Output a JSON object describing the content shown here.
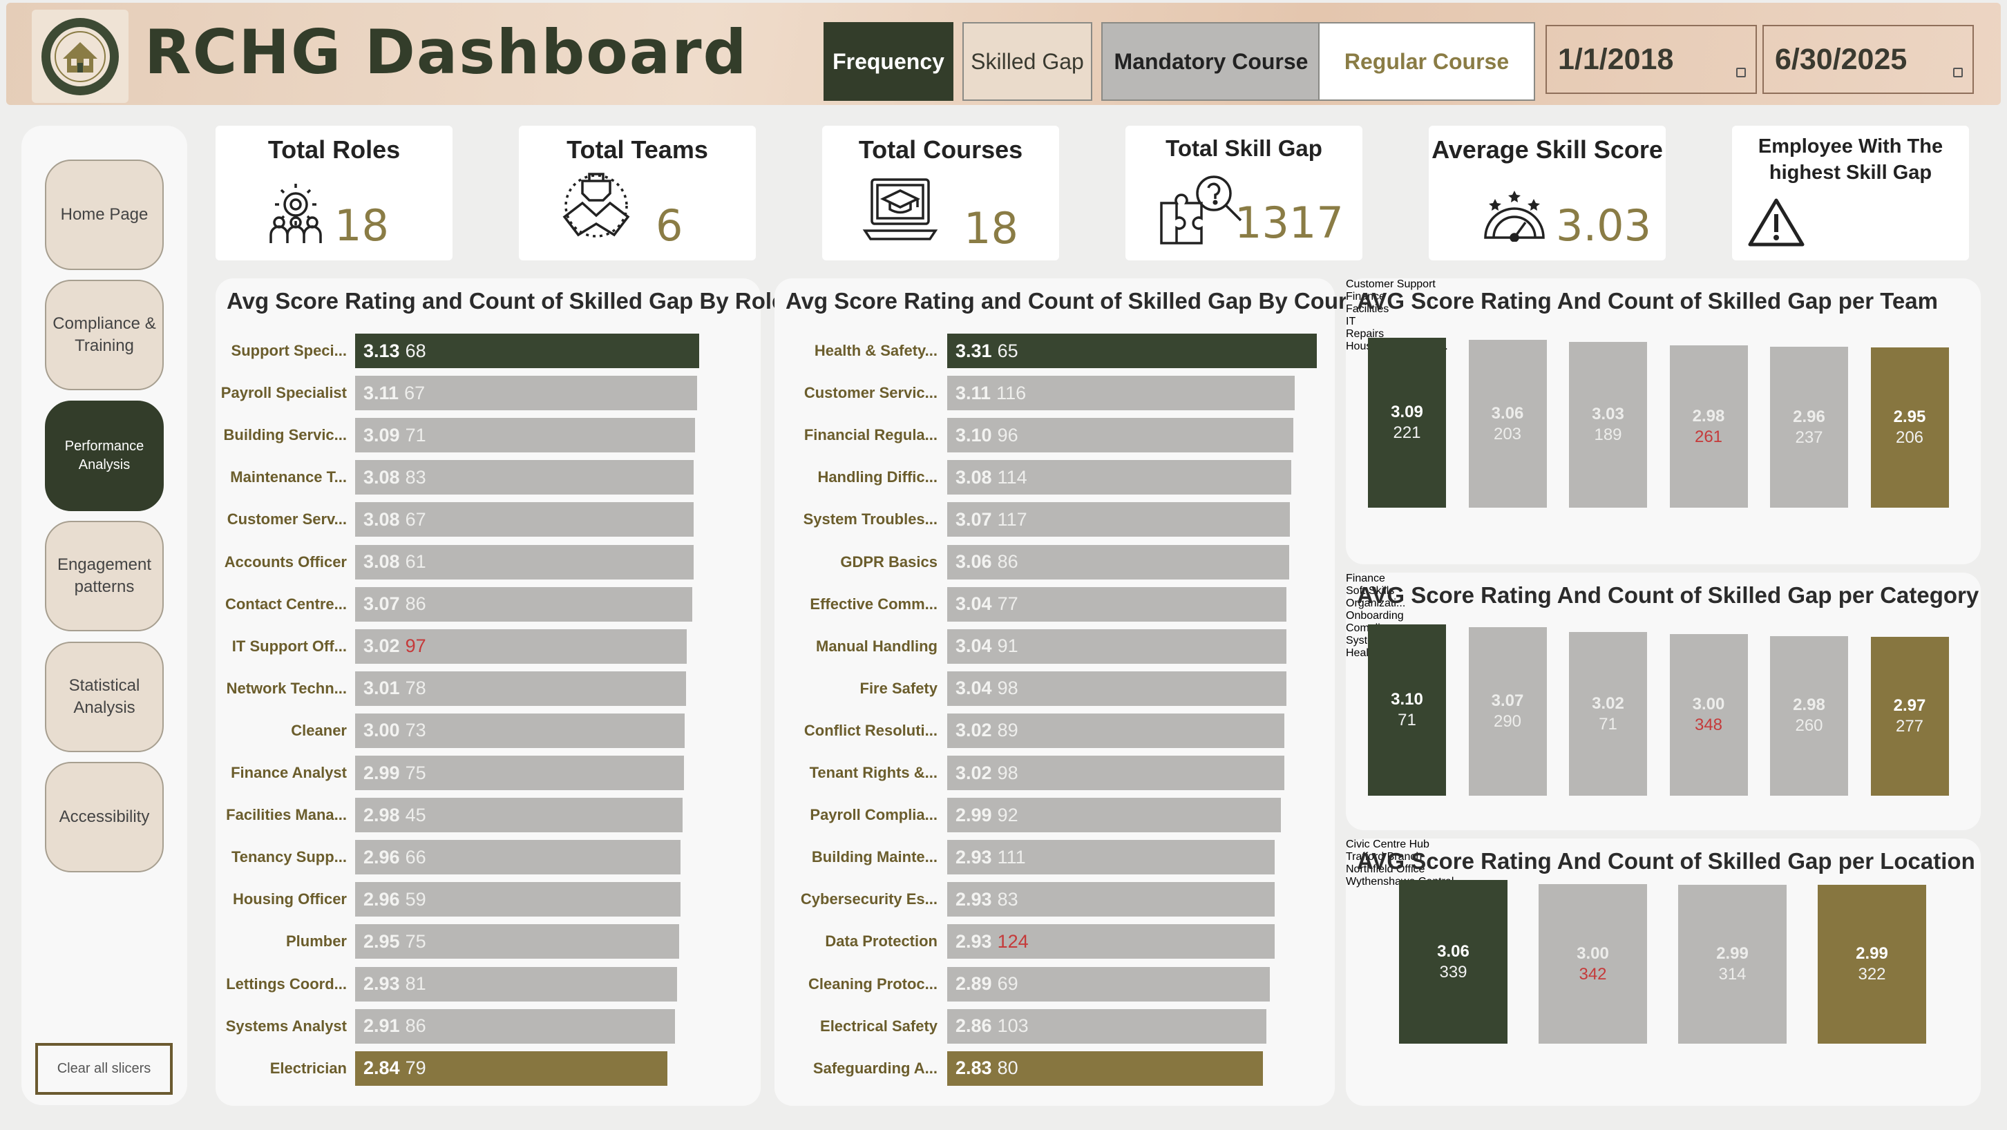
{
  "header": {
    "title": "RCHG Dashboard",
    "logo_text": "WYTHENSHAWE COMMUNITY HOUSING GROUP",
    "toggles": [
      {
        "label": "Frequency",
        "state": "active"
      },
      {
        "label": "Skilled Gap",
        "state": "inactive"
      },
      {
        "label": "Mandatory Course",
        "state": "selected"
      },
      {
        "label": "Regular Course",
        "state": "unselected"
      }
    ],
    "date_start": "1/1/2018",
    "date_end": "6/30/2025"
  },
  "sidebar": {
    "items": [
      "Home Page",
      "Compliance & Training",
      "Performance Analysis",
      "Engagement patterns",
      "Statistical Analysis",
      "Accessibility"
    ],
    "active_index": 2,
    "clear_label": "Clear all slicers"
  },
  "kpis": [
    {
      "title": "Total Roles",
      "value": "18",
      "icon": "team-gear-icon"
    },
    {
      "title": "Total Teams",
      "value": "6",
      "icon": "handshake-icon"
    },
    {
      "title": "Total Courses",
      "value": "18",
      "icon": "laptop-graduation-icon"
    },
    {
      "title": "Total Skill Gap",
      "value": "1317",
      "icon": "puzzle-search-icon"
    },
    {
      "title": "Average Skill Score",
      "value": "3.03",
      "icon": "gauge-stars-icon"
    },
    {
      "title": "Employee With The highest Skill Gap",
      "value": "",
      "icon": "warning-icon"
    }
  ],
  "colors": {
    "dark_green": "#384530",
    "grey": "#b8b7b5",
    "olive": "#877640",
    "label_brown": "#6b5d2c",
    "count_red": "#c53a3a"
  },
  "chart_data": [
    {
      "type": "bar",
      "orientation": "horizontal",
      "title": "Avg Score Rating and Count of Skilled Gap By Role",
      "categories": [
        "Support Speci...",
        "Payroll Specialist",
        "Building Servic...",
        "Maintenance T...",
        "Customer Serv...",
        "Accounts Officer",
        "Contact Centre...",
        "IT Support Off...",
        "Network Techn...",
        "Cleaner",
        "Finance Analyst",
        "Facilities Mana...",
        "Tenancy Supp...",
        "Housing Officer",
        "Plumber",
        "Lettings Coord...",
        "Systems Analyst",
        "Electrician"
      ],
      "series": [
        {
          "name": "Avg Score Rating",
          "values": [
            3.13,
            3.11,
            3.09,
            3.08,
            3.08,
            3.08,
            3.07,
            3.02,
            3.01,
            3.0,
            2.99,
            2.98,
            2.96,
            2.96,
            2.95,
            2.93,
            2.91,
            2.84
          ]
        },
        {
          "name": "Count of Skilled Gap",
          "values": [
            68,
            67,
            71,
            83,
            67,
            61,
            86,
            97,
            78,
            73,
            75,
            45,
            66,
            59,
            75,
            81,
            86,
            79
          ]
        }
      ],
      "highlight": {
        "max_index": 0,
        "min_index": 17,
        "max_count_index": 7
      }
    },
    {
      "type": "bar",
      "orientation": "horizontal",
      "title": "Avg Score Rating and Count of Skilled Gap By Course",
      "categories": [
        "Health & Safety...",
        "Customer Servic...",
        "Financial Regula...",
        "Handling Diffic...",
        "System Troubles...",
        "GDPR Basics",
        "Effective Comm...",
        "Manual Handling",
        "Fire Safety",
        "Conflict Resoluti...",
        "Tenant Rights &...",
        "Payroll Complia...",
        "Building Mainte...",
        "Cybersecurity Es...",
        "Data Protection",
        "Cleaning Protoc...",
        "Electrical Safety",
        "Safeguarding A..."
      ],
      "series": [
        {
          "name": "Avg Score Rating",
          "values": [
            3.31,
            3.11,
            3.1,
            3.08,
            3.07,
            3.06,
            3.04,
            3.04,
            3.04,
            3.02,
            3.02,
            2.99,
            2.93,
            2.93,
            2.93,
            2.89,
            2.86,
            2.83
          ]
        },
        {
          "name": "Count of Skilled Gap",
          "values": [
            65,
            116,
            96,
            114,
            117,
            86,
            77,
            91,
            98,
            89,
            98,
            92,
            111,
            83,
            124,
            69,
            103,
            80
          ]
        }
      ],
      "highlight": {
        "max_index": 0,
        "min_index": 17,
        "max_count_index": 14
      }
    },
    {
      "type": "bar",
      "orientation": "vertical",
      "title": "AVG Score Rating And Count of Skilled Gap per Team",
      "categories": [
        "Customer Support",
        "Finance",
        "Facilities",
        "IT",
        "Repairs",
        "Housing Managem..."
      ],
      "series": [
        {
          "name": "Avg Score Rating",
          "values": [
            3.09,
            3.06,
            3.03,
            2.98,
            2.96,
            2.95
          ]
        },
        {
          "name": "Count of Skilled Gap",
          "values": [
            221,
            203,
            189,
            261,
            237,
            206
          ]
        }
      ],
      "highlight": {
        "max_index": 0,
        "min_index": 5,
        "max_count_index": 3
      }
    },
    {
      "type": "bar",
      "orientation": "vertical",
      "title": "AVG Score Rating And Count of Skilled Gap per Category",
      "categories": [
        "Finance",
        "Soft Skills",
        "Organizati... Onboarding",
        "Compliance",
        "Systems Training",
        "Health & Safety"
      ],
      "series": [
        {
          "name": "Avg Score Rating",
          "values": [
            3.1,
            3.07,
            3.02,
            3.0,
            2.98,
            2.97
          ]
        },
        {
          "name": "Count of Skilled Gap",
          "values": [
            71,
            290,
            71,
            348,
            260,
            277
          ]
        }
      ],
      "highlight": {
        "max_index": 0,
        "min_index": 5,
        "max_count_index": 3
      }
    },
    {
      "type": "bar",
      "orientation": "vertical",
      "title": "AVG Score Rating And Count of Skilled Gap per Location",
      "categories": [
        "Civic Centre Hub",
        "Trafford Branch",
        "Northfield Office",
        "Wythenshawe Central"
      ],
      "series": [
        {
          "name": "Avg Score Rating",
          "values": [
            3.06,
            3.0,
            2.99,
            2.99
          ]
        },
        {
          "name": "Count of Skilled Gap",
          "values": [
            339,
            342,
            314,
            322
          ]
        }
      ],
      "highlight": {
        "max_index": 0,
        "min_index": 3,
        "max_count_index": 1
      }
    }
  ]
}
